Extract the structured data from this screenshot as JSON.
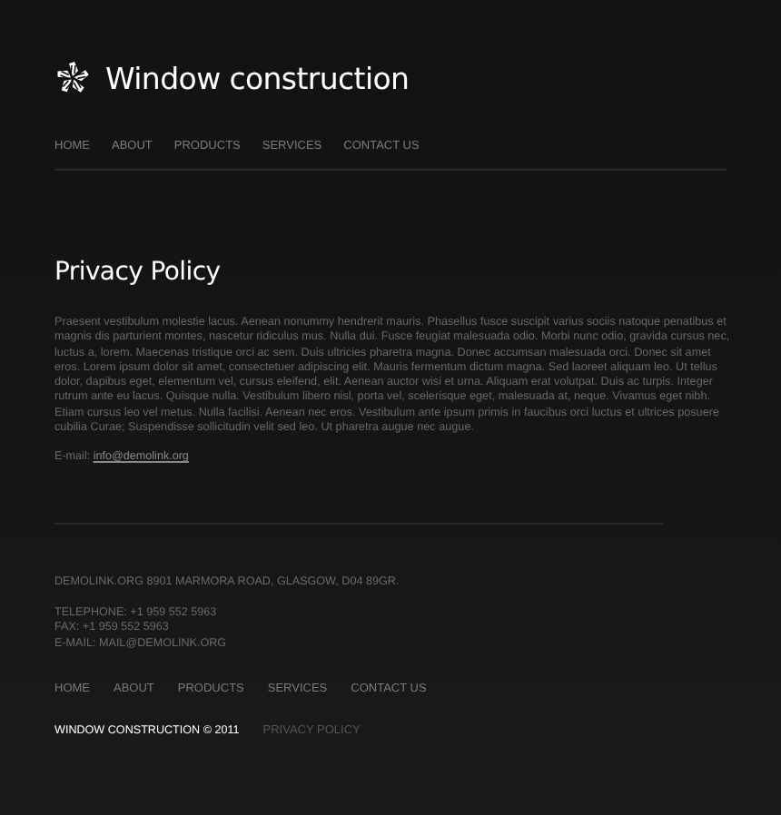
{
  "header": {
    "title": "Window construction"
  },
  "nav": [
    {
      "label": "HOME"
    },
    {
      "label": "ABOUT"
    },
    {
      "label": "PRODUCTS"
    },
    {
      "label": "SERVICES"
    },
    {
      "label": "CONTACT US"
    }
  ],
  "content": {
    "heading": "Privacy Policy",
    "paragraph": "Praesent vestibulum molestie lacus. Aenean nonummy hendrerit mauris. Phasellus fusce suscipit varius sociis natoque penatibus et magnis dis parturient montes, nascetur ridiculus mus. Nulla dui. Fusce feugiat malesuada odio. Morbi nunc odio, gravida cursus nec, luctus a, lorem. Maecenas tristique orci ac sem. Duis ultricies pharetra magna. Donec accumsan malesuada orci. Donec sit amet eros. Lorem ipsum dolor sit amet, consectetuer adipiscing elit. Mauris fermentum dictum magna. Sed laoreet aliquam leo. Ut tellus dolor, dapibus eget, elementum vel, cursus eleifend, elit. Aenean auctor wisi et urna. Aliquam erat volutpat. Duis ac turpis. Integer rutrum ante eu lacus. Quisque nulla. Vestibulum libero nisl, porta vel, scelerisque eget, malesuada at, neque. Vivamus eget nibh. Etiam cursus leo vel metus. Nulla facilisi. Aenean nec eros. Vestibulum ante ipsum primis in faucibus orci luctus et ultrices posuere cubilia Curae; Suspendisse sollicitudin velit sed leo. Ut pharetra augue nec augue.",
    "email_label": "E-mail:",
    "email_link": "info@demolink.org"
  },
  "footer": {
    "address": "DEMOLINK.ORG  8901 MARMORA ROAD, GLASGOW,  D04 89GR.",
    "contacts": [
      "TELEPHONE: +1 959 552 5963",
      "FAX: +1 959 552 5963",
      "E-MAIL: MAIL@DEMOLINK.ORG"
    ],
    "nav": [
      {
        "label": "HOME"
      },
      {
        "label": "ABOUT"
      },
      {
        "label": "PRODUCTS"
      },
      {
        "label": "SERVICES"
      },
      {
        "label": "CONTACT US"
      }
    ],
    "copyright": "WINDOW CONSTRUCTION © 2011",
    "privacy_link": "PRIVACY POLICY"
  }
}
